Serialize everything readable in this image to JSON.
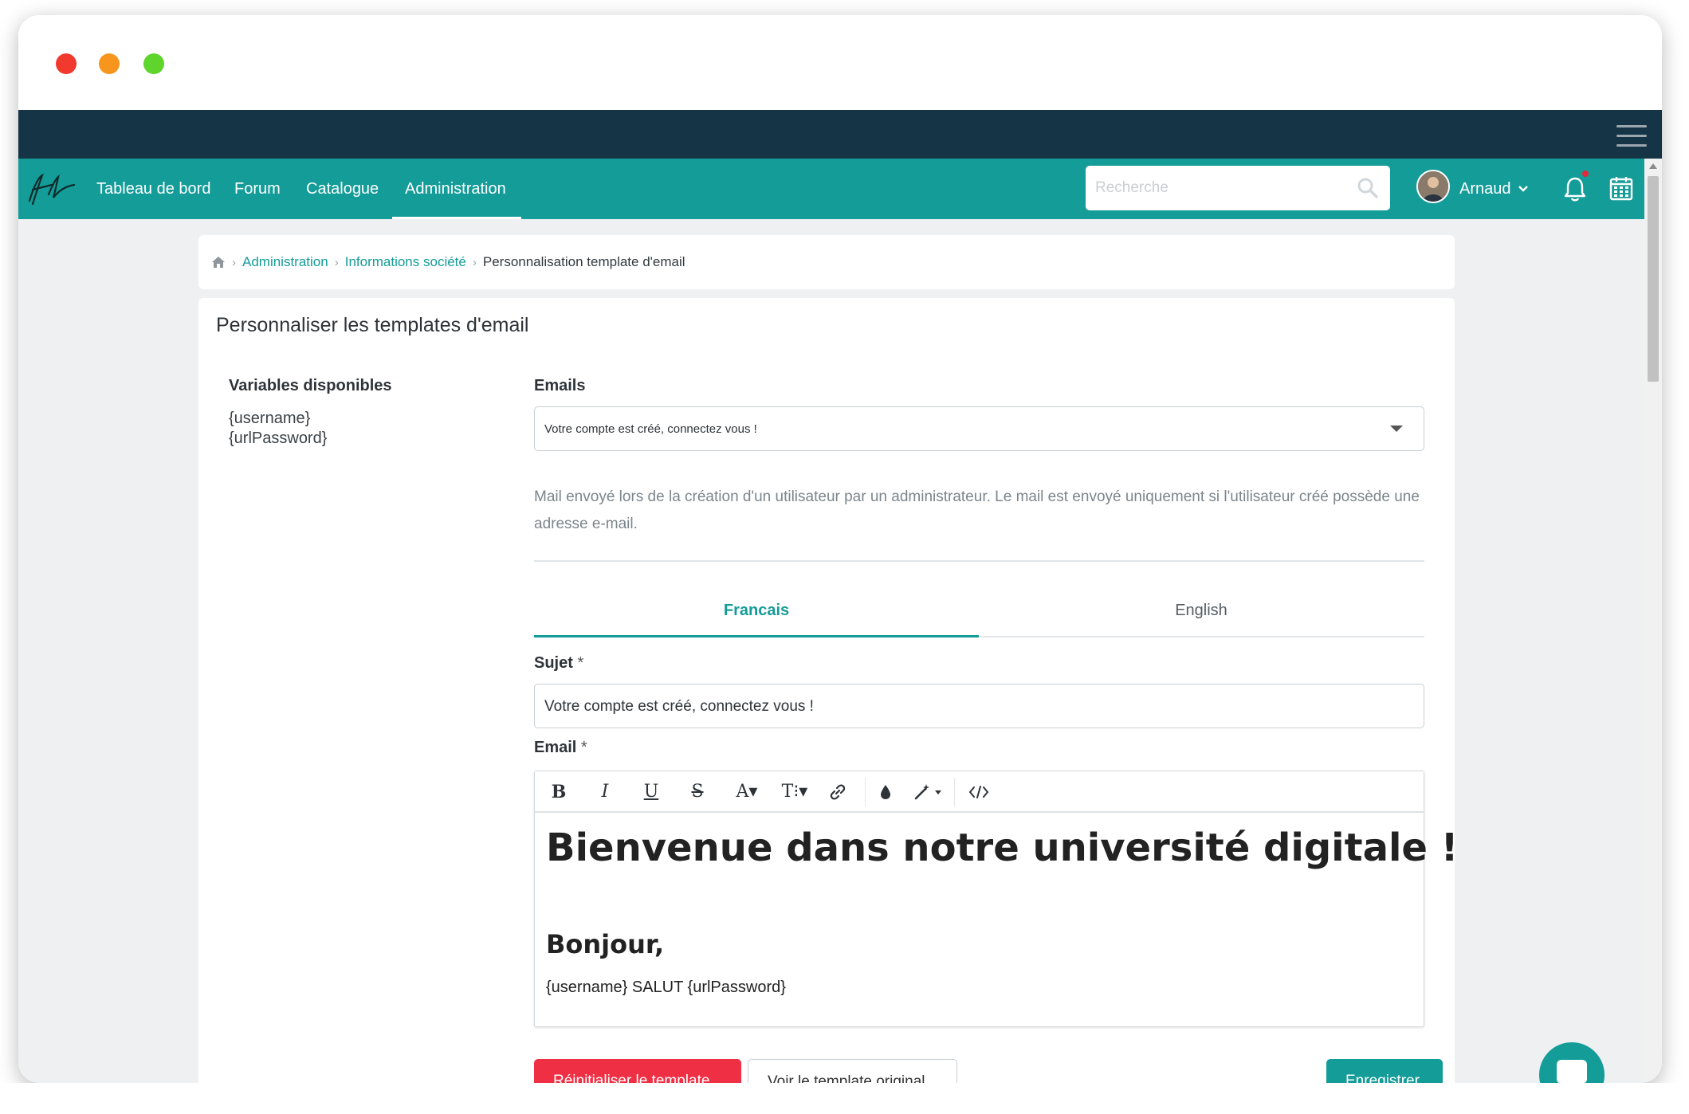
{
  "nav": {
    "items": [
      "Tableau de bord",
      "Forum",
      "Catalogue",
      "Administration"
    ],
    "active": "Administration",
    "search_placeholder": "Recherche",
    "user_name": "Arnaud"
  },
  "breadcrumb": {
    "items": [
      "Administration",
      "Informations société"
    ],
    "current": "Personnalisation template d'email"
  },
  "page": {
    "title": "Personnaliser les templates d'email",
    "variables_title": "Variables disponibles",
    "variables": [
      "{username}",
      "{urlPassword}"
    ],
    "emails_label": "Emails",
    "emails_selected": "Votre compte est créé, connectez vous !",
    "description": "Mail envoyé lors de la création d'un utilisateur par un administrateur. Le mail est envoyé uniquement si l'utilisateur créé possède une adresse e-mail.",
    "tabs": [
      "Francais",
      "English"
    ],
    "active_tab": "Francais",
    "subject_label": "Sujet",
    "subject_value": "Votre compte est créé, connectez vous !",
    "email_label": "Email",
    "required_mark": "*"
  },
  "editor": {
    "toolbar": [
      "B",
      "I",
      "U",
      "S",
      "A▾",
      "T⁝▾",
      "link",
      "color",
      "magic",
      "code"
    ],
    "heading": "Bienvenue dans notre université digitale !",
    "subheading": "Bonjour,",
    "body": "{username} SALUT {urlPassword}"
  },
  "buttons": {
    "reset": "Réinitialiser le template",
    "view": "Voir le template original",
    "save": "Enregistrer"
  },
  "colors": {
    "primary": "#149c98",
    "topbar": "#153446",
    "danger": "#ef2f44"
  }
}
